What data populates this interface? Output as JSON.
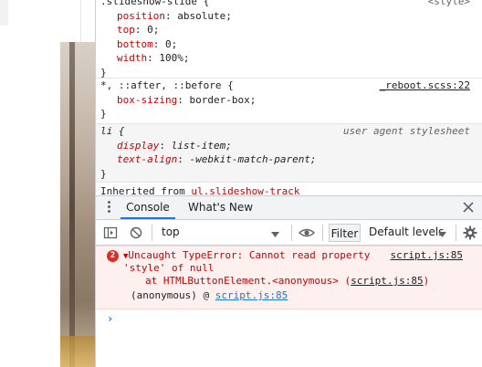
{
  "styles_pane": {
    "rule1": {
      "selector": ".slideshow-slide {",
      "source": "<style>",
      "props": [
        {
          "name": "position",
          "value": "absolute;"
        },
        {
          "name": "top",
          "value": "0;"
        },
        {
          "name": "bottom",
          "value": "0;"
        },
        {
          "name": "width",
          "value": "100%;"
        }
      ],
      "close": "}"
    },
    "rule2": {
      "selector": "*, ::after, ::before {",
      "source": "_reboot.scss:22",
      "props": [
        {
          "name": "box-sizing",
          "value": "border-box;"
        }
      ],
      "close": "}"
    },
    "rule3": {
      "selector": "li {",
      "source": "user agent stylesheet",
      "props": [
        {
          "name": "display",
          "value": "list-item;"
        },
        {
          "name": "text-align",
          "value": "-webkit-match-parent;"
        }
      ],
      "close": "}"
    },
    "inherited": {
      "label": "Inherited from",
      "selector": "ul.slideshow-track"
    }
  },
  "drawer": {
    "tabs": [
      {
        "label": "Console",
        "active": true
      },
      {
        "label": "What's New",
        "active": false
      }
    ]
  },
  "console_toolbar": {
    "context": "top",
    "filter_label": "Filter",
    "levels_label": "Default levels"
  },
  "console": {
    "error_count": "2",
    "error_line1": "Uncaught TypeError: Cannot read property",
    "error_line2": "'style' of null",
    "error_at_prefix": "at HTMLButtonElement.<anonymous> (",
    "error_at_link": "script.js:85",
    "error_at_suffix": ")",
    "error_source": "script.js:85",
    "anon_prefix": "(anonymous) @ ",
    "anon_link": "script.js:85",
    "prompt": "›"
  },
  "icons": [
    "kebab-menu-icon",
    "close-icon",
    "sidebar-toggle-icon",
    "clear-console-icon",
    "eye-icon",
    "settings-gear-icon",
    "dropdown-arrow-icon"
  ],
  "colors": {
    "property_name": "#c80000",
    "error_background": "#fef0ef",
    "error_text": "#c80000",
    "link_blue": "#1a73e8",
    "tab_underline": "#1a73e8"
  }
}
